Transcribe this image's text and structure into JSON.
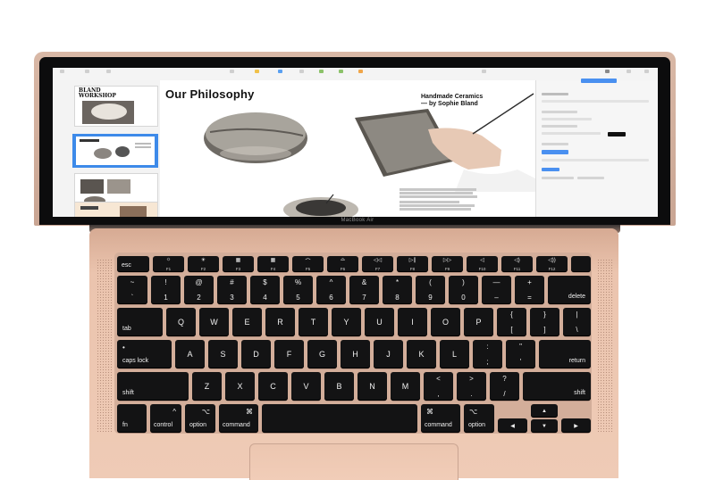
{
  "screen": {
    "slide_title": "Our Philosophy",
    "slide_subtitle_line1": "Handmade Ceramics",
    "slide_subtitle_line2": "— by Sophie Bland",
    "thumb_title_line1": "BLAND",
    "thumb_title_line2": "WORKSHOP"
  },
  "device_label": "MacBook Air",
  "keyboard": {
    "fn_row": [
      {
        "name": "esc",
        "label": "esc"
      },
      {
        "name": "f1",
        "glyph": "☼",
        "label": "F1"
      },
      {
        "name": "f2",
        "glyph": "☀",
        "label": "F2"
      },
      {
        "name": "f3",
        "glyph": "▦",
        "label": "F3"
      },
      {
        "name": "f4",
        "glyph": "▦",
        "label": "F4"
      },
      {
        "name": "f5",
        "glyph": "⌒",
        "label": "F5"
      },
      {
        "name": "f6",
        "glyph": "⌓",
        "label": "F6"
      },
      {
        "name": "f7",
        "glyph": "◁◁",
        "label": "F7"
      },
      {
        "name": "f8",
        "glyph": "▷∥",
        "label": "F8"
      },
      {
        "name": "f9",
        "glyph": "▷▷",
        "label": "F9"
      },
      {
        "name": "f10",
        "glyph": "◁",
        "label": "F10"
      },
      {
        "name": "f11",
        "glyph": "◁)",
        "label": "F11"
      },
      {
        "name": "f12",
        "glyph": "◁))",
        "label": "F12"
      }
    ],
    "number_row": [
      {
        "top": "~",
        "bottom": "`"
      },
      {
        "top": "!",
        "bottom": "1"
      },
      {
        "top": "@",
        "bottom": "2"
      },
      {
        "top": "#",
        "bottom": "3"
      },
      {
        "top": "$",
        "bottom": "4"
      },
      {
        "top": "%",
        "bottom": "5"
      },
      {
        "top": "^",
        "bottom": "6"
      },
      {
        "top": "&",
        "bottom": "7"
      },
      {
        "top": "*",
        "bottom": "8"
      },
      {
        "top": "(",
        "bottom": "9"
      },
      {
        "top": ")",
        "bottom": "0"
      },
      {
        "top": "—",
        "bottom": "–"
      },
      {
        "top": "+",
        "bottom": "="
      }
    ],
    "delete": "delete",
    "tab": "tab",
    "qwerty_row": [
      "Q",
      "W",
      "E",
      "R",
      "T",
      "Y",
      "U",
      "I",
      "O",
      "P"
    ],
    "bracket_keys": [
      {
        "top": "{",
        "bottom": "["
      },
      {
        "top": "}",
        "bottom": "]"
      },
      {
        "top": "|",
        "bottom": "\\"
      }
    ],
    "caps_lock": "caps lock",
    "caps_dot": "•",
    "home_row": [
      "A",
      "S",
      "D",
      "F",
      "G",
      "H",
      "J",
      "K",
      "L"
    ],
    "home_punct": [
      {
        "top": ":",
        "bottom": ";"
      },
      {
        "top": "\"",
        "bottom": "'"
      }
    ],
    "return": "return",
    "shift": "shift",
    "bottom_letters": [
      "Z",
      "X",
      "C",
      "V",
      "B",
      "N",
      "M"
    ],
    "bottom_punct": [
      {
        "top": "<",
        "bottom": ","
      },
      {
        "top": ">",
        "bottom": "."
      },
      {
        "top": "?",
        "bottom": "/"
      }
    ],
    "fn": "fn",
    "control": "control",
    "control_glyph": "^",
    "option": "option",
    "option_glyph": "⌥",
    "command": "command",
    "command_glyph": "⌘",
    "arrow_left": "◀",
    "arrow_up": "▲",
    "arrow_down": "▼",
    "arrow_right": "▶"
  }
}
